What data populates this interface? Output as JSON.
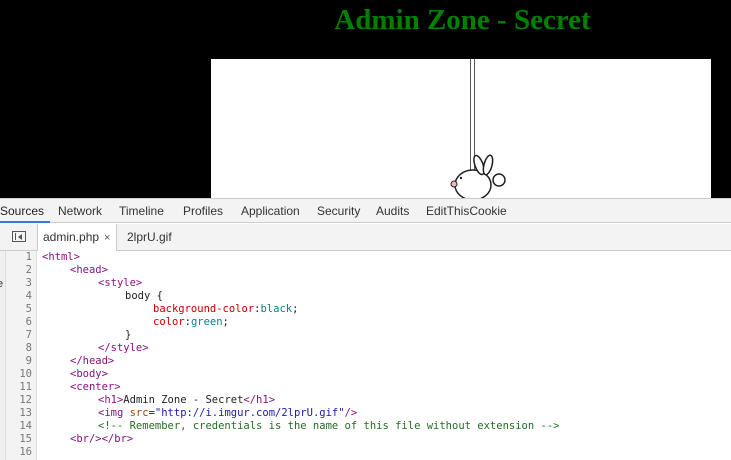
{
  "page": {
    "title": "Admin Zone - Secret",
    "colors": {
      "background": "#000000",
      "text": "#008000"
    },
    "image_alt_icon": "cartoon-bunny-on-pole"
  },
  "devtools": {
    "panel_tabs": [
      "Sources",
      "Network",
      "Timeline",
      "Profiles",
      "Application",
      "Security",
      "Audits",
      "EditThisCookie"
    ],
    "active_panel": "Sources",
    "file_tabs": [
      {
        "label": "admin.php",
        "close": "×"
      },
      {
        "label": "2lprU.gif"
      }
    ],
    "left_strip_char": "e",
    "code": {
      "line_numbers": [
        "1",
        "2",
        "3",
        "4",
        "5",
        "6",
        "7",
        "8",
        "9",
        "10",
        "11",
        "12",
        "13",
        "14",
        "15",
        "16"
      ],
      "l1": "<html>",
      "l2": "<head>",
      "l3": "<style>",
      "l4": "body {",
      "l5_prop": "background-color",
      "l5_val": "black",
      "l6_prop": "color",
      "l6_val": "green",
      "l7": "}",
      "l8": "</style>",
      "l9": "</head>",
      "l10": "<body>",
      "l11": "<center>",
      "l12_open": "<h1>",
      "l12_text": "Admin Zone - Secret",
      "l12_close": "</h1>",
      "l13_tag": "<img ",
      "l13_attr": "src",
      "l13_val": "\"http://i.imgur.com/2lprU.gif\"",
      "l13_end": "/>",
      "l14": "<!-- Remember, credentials is the name of this file without extension -->",
      "l15": "<br/></br>"
    }
  }
}
